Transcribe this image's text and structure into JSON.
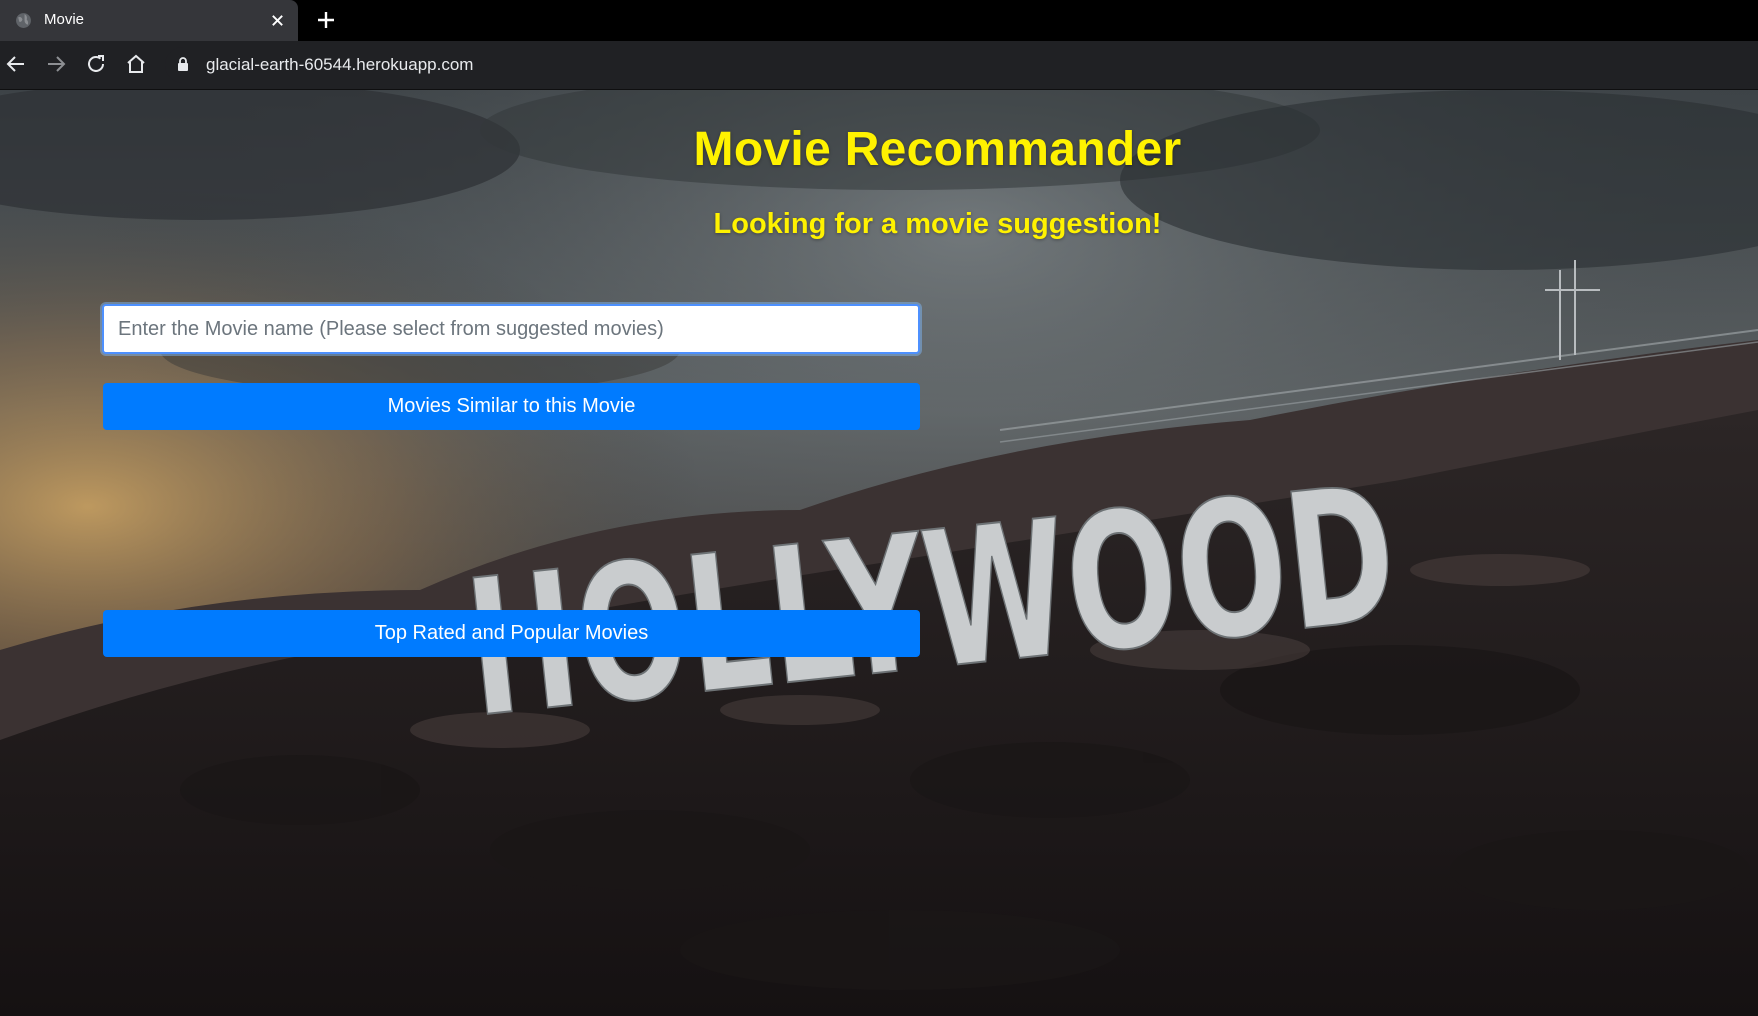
{
  "browser": {
    "tab_title": "Movie",
    "url": "glacial-earth-60544.herokuapp.com"
  },
  "page": {
    "title": "Movie Recommander",
    "subtitle": "Looking for a movie suggestion!",
    "search": {
      "placeholder": "Enter the Movie name (Please select from suggested movies)",
      "value": ""
    },
    "similar_button_label": "Movies Similar to this Movie",
    "top_rated_button_label": "Top Rated and Popular Movies",
    "background_sign_text": "HOLLYWOOD"
  },
  "colors": {
    "accent": "#007bff",
    "heading": "#fff200"
  }
}
